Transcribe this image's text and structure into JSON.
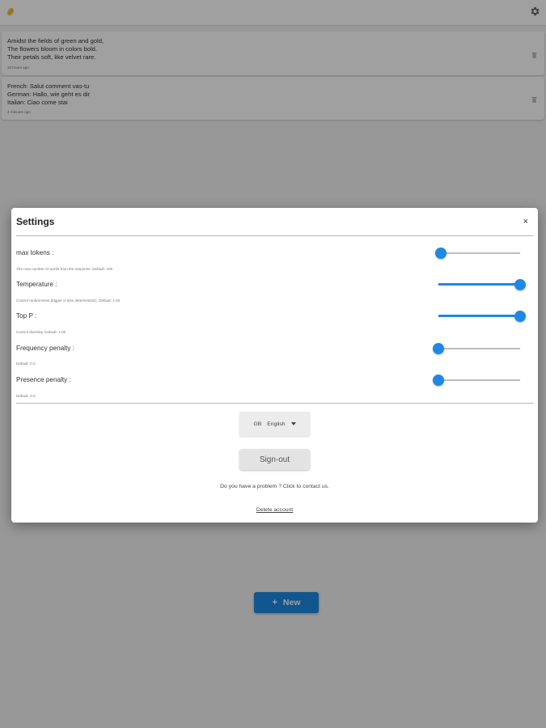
{
  "colors": {
    "accent": "#1e88e5",
    "logo": "#f2c94c"
  },
  "header": {
    "logo_icon": "logo-icon",
    "settings_icon": "gear-icon"
  },
  "history": [
    {
      "text": "Amidst the fields of green and gold,\nThe flowers bloom in colors bold.\nTheir petals soft, like velvet rare.",
      "time": "16 hours ago"
    },
    {
      "text": "French: Salut comment vas-tu\nGerman: Hallo, wie geht es dir\nItalian: Ciao come stai",
      "time": "4 minutes ago"
    }
  ],
  "new_button": {
    "icon": "+",
    "label": "New"
  },
  "settings": {
    "title": "Settings",
    "close": "×",
    "items": [
      {
        "label": "max tokens :",
        "description": "The max number of words from the response. Default: 108",
        "value": 0.03
      },
      {
        "label": "Temperature :",
        "description": "Control randomness (bigger is less deterministic). Default: 1.00",
        "value": 1.0
      },
      {
        "label": "Top P :",
        "description": "Control diversity. Default: 1.00",
        "value": 1.0
      },
      {
        "label": "Frequency penalty :",
        "description": "Default: 0.0",
        "value": 0.0
      },
      {
        "label": "Presence penalty :",
        "description": "Default: 0.0",
        "value": 0.0
      }
    ],
    "language": {
      "flag": "GB",
      "selected": "English"
    },
    "signout_label": "Sign-out",
    "problem_text": "Do you have a problem ?  Click to contact us.",
    "delete_label": "Delete account"
  }
}
